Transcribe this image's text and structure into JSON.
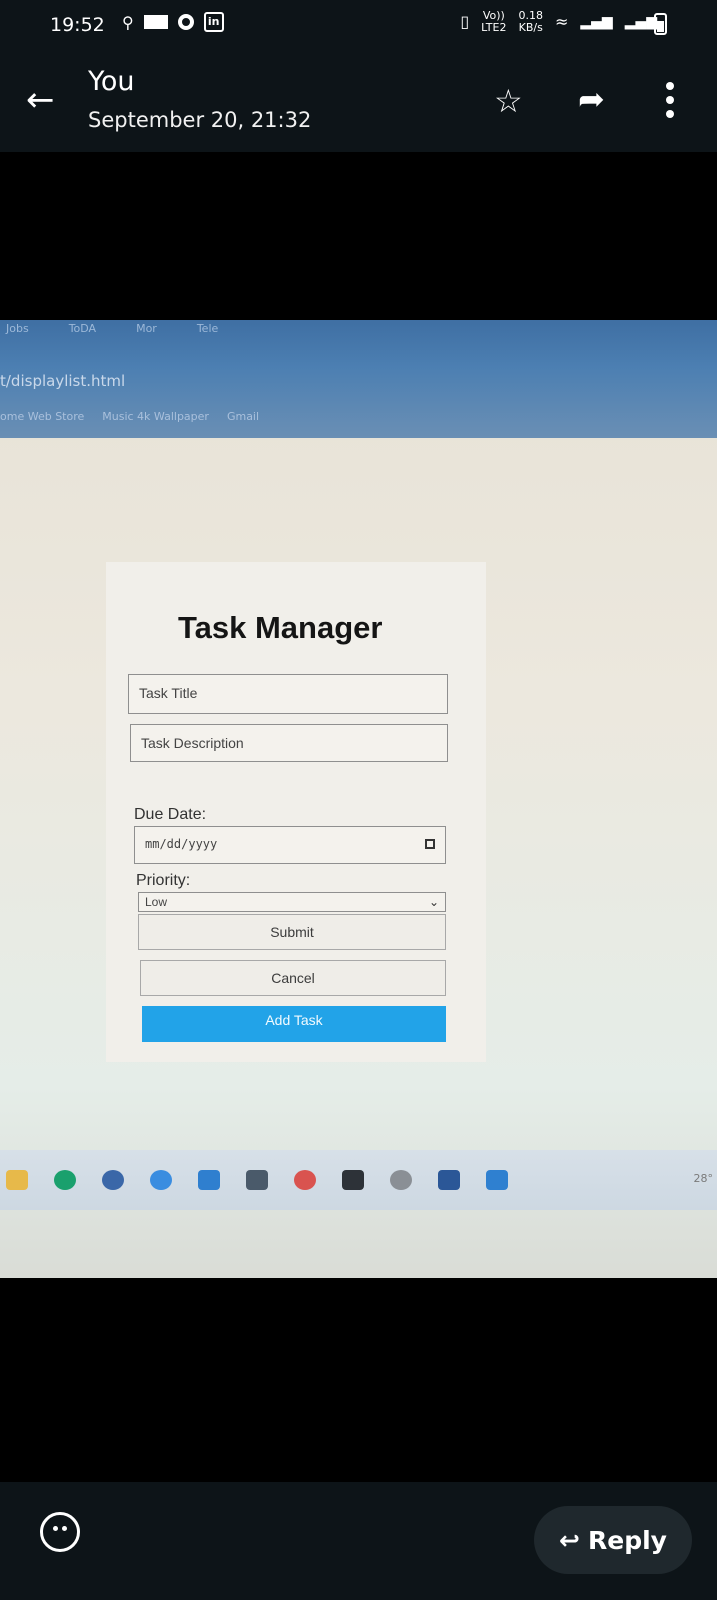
{
  "status_bar": {
    "time": "19:52",
    "network_type": "LTE2",
    "volte": "Vo))",
    "data_rate_value": "0.18",
    "data_rate_unit": "KB/s"
  },
  "header": {
    "sender": "You",
    "date": "September 20, 21:32"
  },
  "photo": {
    "browser": {
      "tabs": [
        "Jobs",
        "ToDA",
        "Mor",
        "Tele"
      ],
      "url": "t/displaylist.html",
      "bookmarks": [
        "ome Web Store",
        "Music 4k Wallpaper",
        "Gmail"
      ]
    },
    "form": {
      "title": "Task Manager",
      "title_placeholder": "Task Title",
      "description_placeholder": "Task Description",
      "due_date_label": "Due Date:",
      "date_placeholder": "mm/dd/yyyy",
      "priority_label": "Priority:",
      "priority_selected": "Low",
      "submit_label": "Submit",
      "cancel_label": "Cancel",
      "add_task_label": "Add Task"
    },
    "taskbar": {
      "temperature": "28°"
    },
    "colors": {
      "add_task_button": "#22a3e8",
      "browser_chrome": "#4c7fb2"
    }
  },
  "footer": {
    "reply_label": "Reply"
  }
}
